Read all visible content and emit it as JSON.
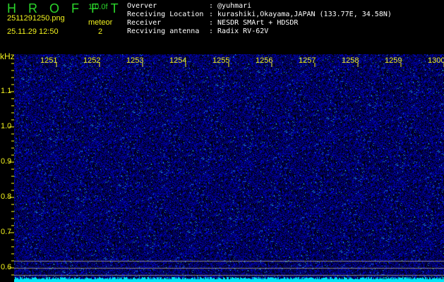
{
  "header": {
    "logo": "H R O F F T",
    "version": "1.0.0f",
    "filename": "2511291250.png",
    "datetime": "25.11.29 12:50",
    "meteor_label": "meteor",
    "meteor_count": "2"
  },
  "info": {
    "labels": [
      "Overver",
      "Receiving Location",
      "Receiver",
      "Recviving antenna"
    ],
    "values": [
      ": @yuhmari",
      ": kurashiki,Okayama,JAPAN (133.77E, 34.58N)",
      ": NESDR SMArt + HDSDR",
      ": Radix RV-62V"
    ]
  },
  "axis": {
    "unit": "kHz",
    "x_ticks": [
      "1251",
      "1252",
      "1253",
      "1254",
      "1255",
      "1256",
      "1257",
      "1258",
      "1259",
      "1300"
    ],
    "y_ticks": [
      "1.1",
      "1.0",
      "0.9",
      "0.8",
      "0.7",
      "0.6"
    ]
  },
  "colors": {
    "bg": "#000000",
    "noise": "#1a1acc",
    "trace": "#00ffff",
    "label": "#f2f21e"
  }
}
